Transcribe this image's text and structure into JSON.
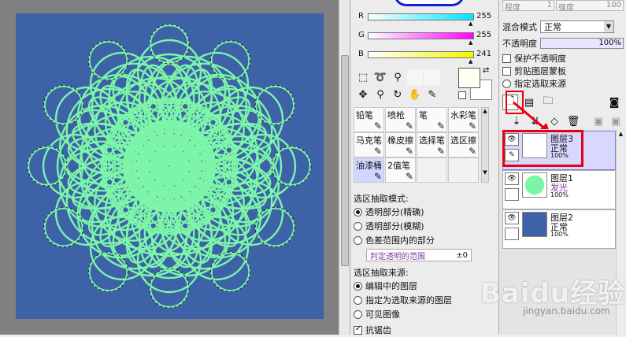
{
  "sliders": [
    {
      "label": "R",
      "value": "255",
      "color": "#00e5ff"
    },
    {
      "label": "G",
      "value": "255",
      "color": "#ff00ff"
    },
    {
      "label": "B",
      "value": "241",
      "color": "#f5f500"
    }
  ],
  "tools": [
    [
      "铅笔",
      "喷枪",
      "笔",
      "水彩笔"
    ],
    [
      "马克笔",
      "橡皮擦",
      "选择笔",
      "选区擦"
    ],
    [
      "油漆桶",
      "2值笔",
      "",
      ""
    ]
  ],
  "selection": {
    "mode_title": "选区抽取模式:",
    "modes": [
      "透明部分(精确)",
      "透明部分(模糊)",
      "色差范围内的部分"
    ],
    "range_label": "判定透明的范围",
    "range_value": "±0",
    "source_title": "选区抽取来源:",
    "sources": [
      "编辑中的图层",
      "指定为选取来源的图层",
      "可见图像"
    ],
    "antialias": "抗锯齿"
  },
  "top_right": {
    "density": "程度",
    "density_val": "1",
    "strength": "强度",
    "strength_val": "100"
  },
  "blend": {
    "label": "混合模式",
    "value": "正常",
    "opacity_label": "不透明度",
    "opacity_value": "100%"
  },
  "checks": [
    "保护不透明度",
    "剪贴图层蒙板",
    "指定选取来源"
  ],
  "layers": [
    {
      "name": "图层3",
      "mode": "正常",
      "opacity": "100%",
      "thumb": "#ffffff",
      "selected": true
    },
    {
      "name": "图层1",
      "mode": "发光",
      "opacity": "100%",
      "thumb": "#7cf5a8",
      "selected": false
    },
    {
      "name": "图层2",
      "mode": "正常",
      "opacity": "100%",
      "thumb": "#3d62a8",
      "selected": false
    }
  ],
  "watermark": {
    "text": "Baidu经验",
    "sub": "jingyan.baidu.com"
  },
  "colors": {
    "accent_red": "#e60012",
    "artwork_bg": "#3d62a8",
    "pattern": "#7cf5a8",
    "selected_layer": "#d8d8ff"
  }
}
